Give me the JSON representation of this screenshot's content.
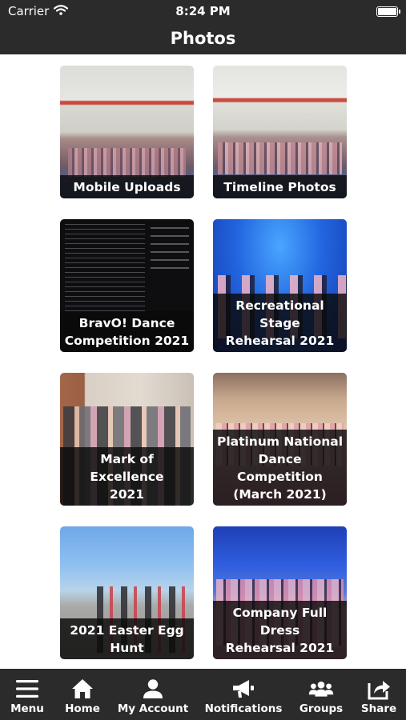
{
  "status_bar": {
    "carrier": "Carrier",
    "time": "8:24 PM",
    "wifi_icon": "wifi-icon",
    "battery_icon": "battery-icon"
  },
  "nav": {
    "title": "Photos"
  },
  "albums": [
    {
      "name": "album-mobile-uploads",
      "label": "Mobile Uploads"
    },
    {
      "name": "album-timeline-photos",
      "label": "Timeline Photos"
    },
    {
      "name": "album-bravo-dance-competition-2021",
      "label": "BravO! Dance\nCompetition 2021"
    },
    {
      "name": "album-recreational-stage-rehearsal-2021",
      "label": "Recreational Stage\nRehearsal 2021"
    },
    {
      "name": "album-mark-of-excellence-2021",
      "label": "Mark of Excellence\n2021"
    },
    {
      "name": "album-platinum-national-dance-competition",
      "label": "Platinum National\nDance Competition\n(March 2021)"
    },
    {
      "name": "album-2021-easter-egg-hunt",
      "label": "2021 Easter Egg\nHunt"
    },
    {
      "name": "album-company-full-dress-rehearsal-2021",
      "label": "Company Full Dress\nRehearsal 2021"
    }
  ],
  "tab_bar": {
    "items": [
      {
        "label": "Menu",
        "icon": "hamburger-menu-icon"
      },
      {
        "label": "Home",
        "icon": "home-icon"
      },
      {
        "label": "My Account",
        "icon": "user-icon"
      },
      {
        "label": "Notifications",
        "icon": "megaphone-icon"
      },
      {
        "label": "Groups",
        "icon": "group-icon"
      },
      {
        "label": "Share",
        "icon": "share-icon"
      }
    ]
  },
  "colors": {
    "bar_background": "#2b2b2b",
    "caption_background": "#0a0a0a",
    "text": "#ffffff"
  }
}
